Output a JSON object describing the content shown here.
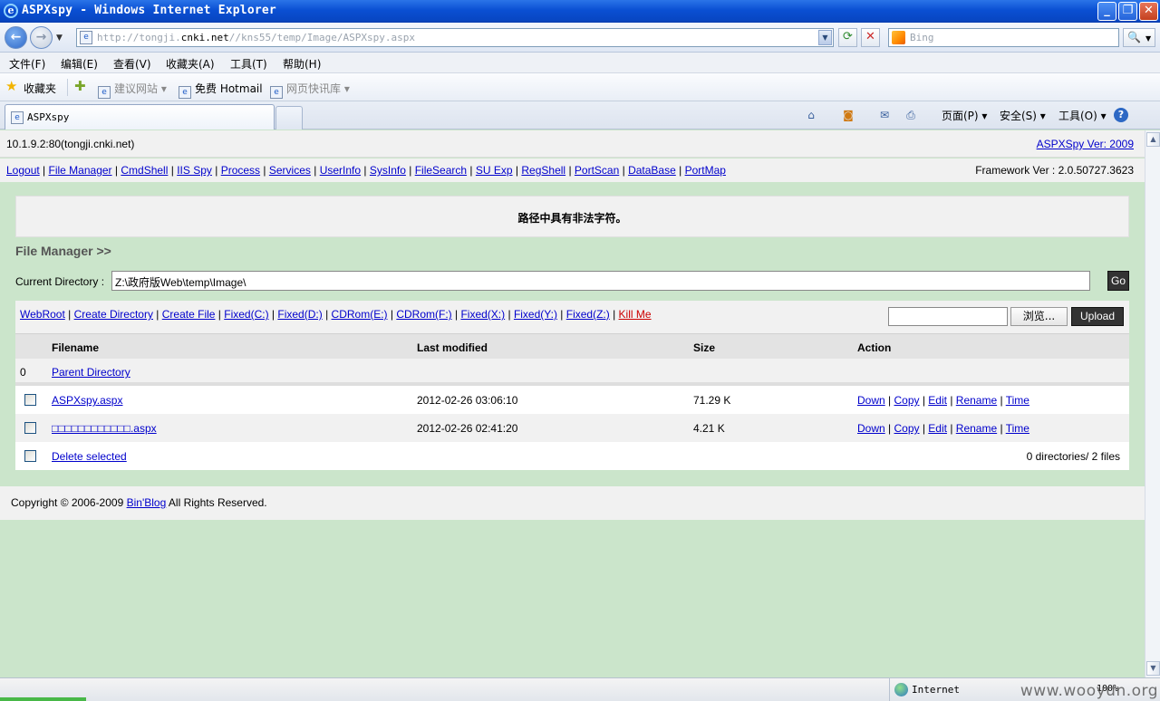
{
  "window": {
    "title": "ASPXspy - Windows Internet Explorer",
    "controls": [
      "_",
      "❐",
      "✕"
    ]
  },
  "address": {
    "url_prefix": "http://tongji.",
    "url_domain": "cnki.net",
    "url_suffix": "//kns55/temp/Image/ASPXspy.aspx",
    "search_placeholder": "Bing"
  },
  "menu": [
    "文件(F)",
    "编辑(E)",
    "查看(V)",
    "收藏夹(A)",
    "工具(T)",
    "帮助(H)"
  ],
  "favorites": {
    "label": "收藏夹",
    "items": [
      "建议网站 ▾",
      "免费 Hotmail",
      "网页快讯库 ▾"
    ]
  },
  "tab": {
    "label": "ASPXspy"
  },
  "commandbar": {
    "page": "页面(P) ▾",
    "safety": "安全(S) ▾",
    "tools": "工具(O) ▾"
  },
  "page": {
    "host": "10.1.9.2:80(tongji.cnki.net)",
    "version_link": "ASPXSpy Ver: 2009",
    "nav_links": [
      "Logout",
      "File Manager",
      "CmdShell",
      "IIS Spy",
      "Process",
      "Services",
      "UserInfo",
      "SysInfo",
      "FileSearch",
      "SU Exp",
      "RegShell",
      "PortScan",
      "DataBase",
      "PortMap"
    ],
    "framework": "Framework Ver : 2.0.50727.3623",
    "message": "路径中具有非法字符。",
    "section_title": "File Manager >>",
    "current_dir_label": "Current Directory :",
    "current_dir_value": "Z:\\政府版Web\\temp\\Image\\",
    "go_label": "Go",
    "tool_links": [
      "WebRoot",
      "Create Directory",
      "Create File",
      "Fixed(C:)",
      "Fixed(D:)",
      "CDRom(E:)",
      "CDRom(F:)",
      "Fixed(X:)",
      "Fixed(Y:)",
      "Fixed(Z:)"
    ],
    "kill_link": "Kill Me",
    "browse_label": "浏览...",
    "upload_label": "Upload",
    "table": {
      "headers": [
        "Filename",
        "Last modified",
        "Size",
        "Action"
      ],
      "parent_index": "0",
      "parent_label": "Parent Directory",
      "files": [
        {
          "name": "ASPXspy.aspx",
          "modified": "2012-02-26 03:06:10",
          "size": "71.29 K"
        },
        {
          "name": "□□□□□□□□□□□□.aspx",
          "modified": "2012-02-26 02:41:20",
          "size": "4.21 K"
        }
      ],
      "actions": [
        "Down",
        "Copy",
        "Edit",
        "Rename",
        "Time"
      ],
      "delete_label": "Delete selected",
      "summary": "0 directories/ 2 files"
    },
    "copyright_prefix": "Copyright © 2006-2009 ",
    "copyright_link": "Bin'Blog",
    "copyright_suffix": " All Rights Reserved."
  },
  "status": {
    "zone": "Internet",
    "zoom": "100%"
  },
  "watermark": "www.wooyun.org"
}
